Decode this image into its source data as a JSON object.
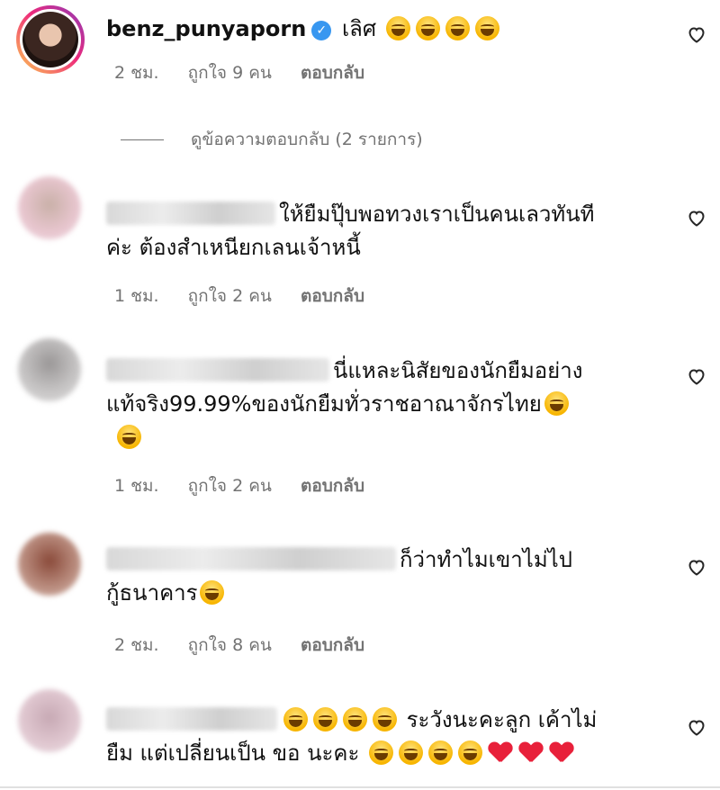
{
  "comments": [
    {
      "username": "benz_punyaporn",
      "verified": true,
      "text": "เลิศ",
      "emoji_count": 4,
      "time": "2 ชม.",
      "likes": "ถูกใจ 9 คน",
      "reply": "ตอบกลับ",
      "view_replies": "ดูข้อความตอบกลับ (2 รายการ)"
    },
    {
      "line1": "ให้ยืมปุ๊บพอทวงเราเป็นคนเลวทันที",
      "line2": "ค่ะ ต้องสำเหนียกเลนเจ้าหนี้",
      "time": "1 ชม.",
      "likes": "ถูกใจ 2 คน",
      "reply": "ตอบกลับ"
    },
    {
      "line1": "นี่แหละนิสัยของนักยืมอย่าง",
      "line2": "แท้จริง99.99%ของนักยืมทั่วราชอาณาจักรไทย",
      "time": "1 ชม.",
      "likes": "ถูกใจ 2 คน",
      "reply": "ตอบกลับ"
    },
    {
      "line1": "ก็ว่าทำไมเขาไม่ไป",
      "line2": "กู้ธนาคาร",
      "time": "2 ชม.",
      "likes": "ถูกใจ 8 คน",
      "reply": "ตอบกลับ"
    },
    {
      "line1": "ระวังนะคะลูก เค้าไม่",
      "line2a": "ยืม แต่เปลี่ยนเป็น ขอ นะคะ"
    }
  ],
  "icons": {
    "like": "heart-outline-icon",
    "verified": "verified-badge-icon",
    "emoji": "face-with-tears-of-joy",
    "heart_emoji": "red-heart"
  },
  "colors": {
    "meta_text": "#737373",
    "verified_badge": "#3897f0",
    "heart_emoji": "#e8203a"
  }
}
